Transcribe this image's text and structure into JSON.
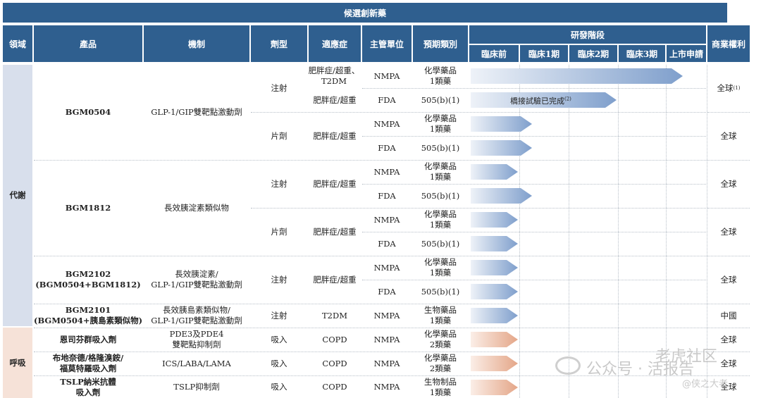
{
  "title": "候選創新藥",
  "headers": {
    "field": "領域",
    "product": "產品",
    "mechanism": "機制",
    "dosage_form": "劑型",
    "indication": "適應症",
    "regulator": "主管單位",
    "category": "預期類別",
    "stage": "研發階段",
    "rights": "商業權利",
    "phases": [
      "臨床前",
      "臨床1期",
      "臨床2期",
      "臨床3期",
      "上市申請"
    ]
  },
  "fields": [
    {
      "name": "代謝",
      "color": "#d8dfec"
    },
    {
      "name": "呼吸",
      "color": "#f6e2d8"
    }
  ],
  "products": [
    {
      "name": "BGM0504",
      "mechanism": "GLP-1/GIP雙靶點激動劑"
    },
    {
      "name": "BGM1812",
      "mechanism": "長效胰淀素類似物"
    },
    {
      "name": "BGM2102\n(BGM0504+BGM1812)",
      "mechanism": "長效胰淀素/\nGLP-1/GIP雙靶點激動劑"
    },
    {
      "name": "BGM2101\n(BGM0504+胰島素類似物)",
      "mechanism": "長效胰島素類似物/\nGLP-1/GIP雙靶點激動劑"
    },
    {
      "name": "恩司芬群吸入劑",
      "mechanism": "PDE3及PDE4\n雙靶點抑制劑"
    },
    {
      "name": "布地奈德/格隆溴銨/\n福莫特羅吸入劑",
      "mechanism": "ICS/LABA/LAMA"
    },
    {
      "name": "TSLP納米抗體\n吸入劑",
      "mechanism": "TSLP抑制劑"
    }
  ],
  "forms": [
    "注射",
    "片劑",
    "注射",
    "片劑",
    "注射",
    "注射",
    "吸入",
    "吸入",
    "吸入"
  ],
  "indications": [
    "肥胖症/超重、\nT2DM",
    "肥胖症/超重",
    "肥胖症/超重",
    "肥胖症/超重",
    "肥胖症/超重",
    "肥胖症/超重",
    "T2DM",
    "COPD",
    "COPD",
    "COPD"
  ],
  "rights": [
    "全球",
    "全球",
    "全球",
    "全球",
    "全球",
    "中國",
    "全球",
    "全球",
    "全球"
  ],
  "rights_note": "(1)",
  "rows": [
    {
      "regulator": "NMPA",
      "category": "化學藥品\n1類藥",
      "progress": 0.9,
      "color": "blue"
    },
    {
      "regulator": "FDA",
      "category": "505(b)(1)",
      "progress": 0.62,
      "color": "blue",
      "label": "橋接試驗已完成",
      "label_note": "(2)"
    },
    {
      "regulator": "NMPA",
      "category": "化學藥品\n1類藥",
      "progress": 0.26,
      "color": "blue"
    },
    {
      "regulator": "FDA",
      "category": "505(b)(1)",
      "progress": 0.26,
      "color": "blue"
    },
    {
      "regulator": "NMPA",
      "category": "化學藥品\n1類藥",
      "progress": 0.2,
      "color": "blue"
    },
    {
      "regulator": "FDA",
      "category": "505(b)(1)",
      "progress": 0.26,
      "color": "blue"
    },
    {
      "regulator": "NMPA",
      "category": "化學藥品\n1類藥",
      "progress": 0.2,
      "color": "blue"
    },
    {
      "regulator": "FDA",
      "category": "505(b)(1)",
      "progress": 0.2,
      "color": "blue"
    },
    {
      "regulator": "NMPA",
      "category": "化學藥品\n1類藥",
      "progress": 0.2,
      "color": "blue"
    },
    {
      "regulator": "FDA",
      "category": "505(b)(1)",
      "progress": 0.2,
      "color": "blue"
    },
    {
      "regulator": "NMPA",
      "category": "生物藥品\n1類藥",
      "progress": 0.2,
      "color": "blue"
    },
    {
      "regulator": "NMPA",
      "category": "化學藥品\n2類藥",
      "progress": 0.2,
      "color": "orange"
    },
    {
      "regulator": "NMPA",
      "category": "化學藥品\n2類藥",
      "progress": 0.2,
      "color": "orange"
    },
    {
      "regulator": "NMPA",
      "category": "生物制品\n1類藥",
      "progress": 0.2,
      "color": "orange"
    }
  ],
  "bar_colors": {
    "blue_start": "#eef2f8",
    "blue_end": "#7f9fcc",
    "orange_start": "#fbeee7",
    "orange_end": "#e4a688"
  },
  "watermark": {
    "line1": "老虎社区",
    "line2": "公众号 · 活报告",
    "line3": "@侠之大者"
  }
}
